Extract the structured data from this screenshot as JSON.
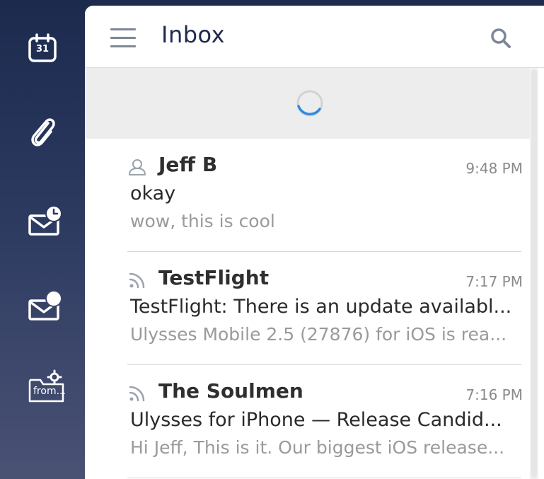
{
  "sidebar": {
    "calendar_day": "31",
    "folder_label": "from..."
  },
  "header": {
    "title": "Inbox"
  },
  "messages": [
    {
      "sender": "Jeff B",
      "sender_icon": "person-icon",
      "time": "9:48 PM",
      "subject": "okay",
      "preview": "wow, this is cool"
    },
    {
      "sender": "TestFlight",
      "sender_icon": "rss-icon",
      "time": "7:17 PM",
      "subject": "TestFlight: There is an update availabl...",
      "preview": "Ulysses Mobile 2.5 (27876) for iOS is rea..."
    },
    {
      "sender": "The Soulmen",
      "sender_icon": "rss-icon",
      "time": "7:16 PM",
      "subject": "Ulysses for iPhone — Release Candid...",
      "preview": "Hi Jeff, This is it. Our biggest iOS release..."
    }
  ],
  "colors": {
    "accent": "#2f8be0",
    "sidebar_top": "#1c2a4e",
    "title": "#1e2a4c"
  }
}
